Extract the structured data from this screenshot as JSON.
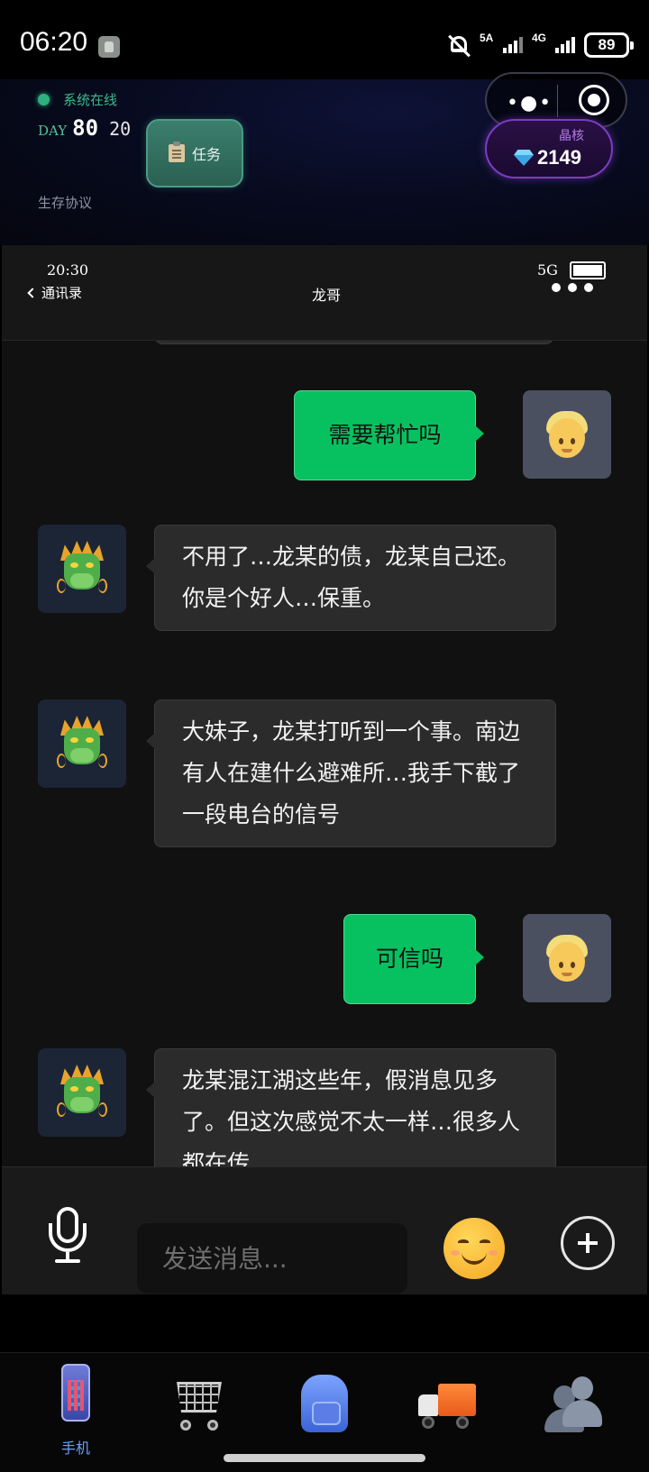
{
  "status_bar": {
    "time": "06:20",
    "network1": "5A",
    "network2": "4G",
    "battery": "89"
  },
  "game_header": {
    "online_status": "系统在线",
    "day_label": "DAY",
    "day_number": "80",
    "day_sub": "20",
    "task_button": "任务",
    "protocol_label": "生存协议",
    "crystal_label": "晶核",
    "crystal_value": "2149"
  },
  "phone": {
    "time": "20:30",
    "network": "5G",
    "back_label": "通讯录",
    "contact_name": "龙哥"
  },
  "messages": [
    {
      "sender": "me",
      "text": "需要帮忙吗"
    },
    {
      "sender": "other",
      "text": "不用了…龙某的债，龙某自己还。你是个好人…保重。"
    },
    {
      "sender": "other",
      "text": "大妹子，龙某打听到一个事。南边有人在建什么避难所…我手下截了一段电台的信号"
    },
    {
      "sender": "me",
      "text": "可信吗"
    },
    {
      "sender": "other",
      "text": "龙某混江湖这些年，假消息见多了。但这次感觉不太一样…很多人都在传"
    }
  ],
  "input": {
    "placeholder": "发送消息..."
  },
  "bottom_nav": {
    "items": [
      {
        "label": "手机",
        "icon": "phone-icon",
        "active": true
      },
      {
        "label": "",
        "icon": "cart-icon"
      },
      {
        "label": "",
        "icon": "backpack-icon"
      },
      {
        "label": "",
        "icon": "truck-icon"
      },
      {
        "label": "",
        "icon": "contacts-icon"
      }
    ]
  },
  "colors": {
    "my_bubble": "#07c160",
    "other_bubble": "#2b2b2b",
    "online_green": "#3fb98c",
    "crystal_purple": "#7b3cc4",
    "nav_active": "#6aa0ff"
  }
}
